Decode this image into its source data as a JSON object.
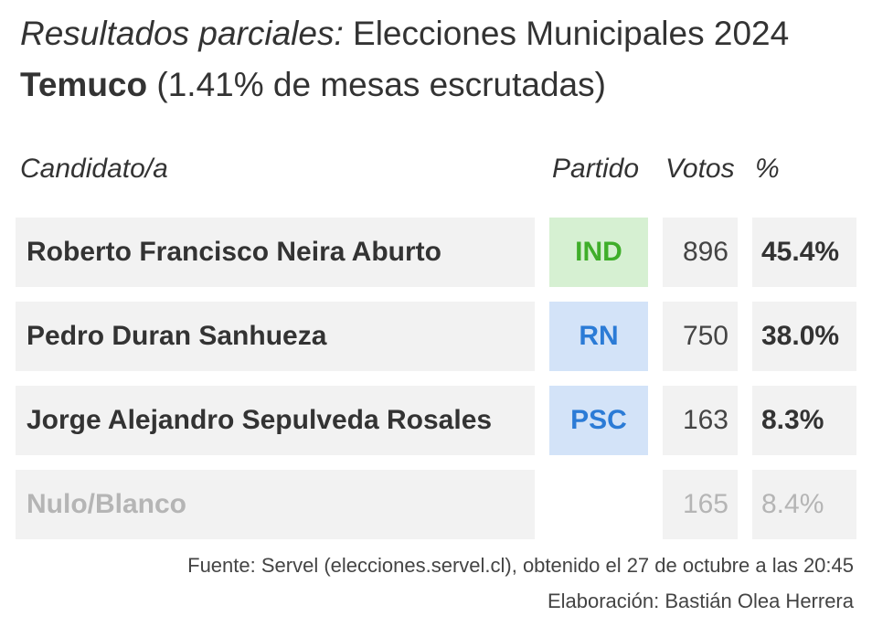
{
  "title": {
    "italic_part": "Resultados parciales:",
    "rest": " Elecciones Municipales 2024",
    "city": "Temuco",
    "progress_text": " (1.41% de mesas escrutadas)"
  },
  "columns": {
    "candidate": "Candidato/a",
    "party": "Partido",
    "votes": "Votos",
    "percent": "%"
  },
  "rows": [
    {
      "name": "Roberto Francisco Neira Aburto",
      "party": "IND",
      "party_bg": "#d6f0d2",
      "party_color": "#3fae2a",
      "votes": "896",
      "percent": "45.4%"
    },
    {
      "name": "Pedro Duran Sanhueza",
      "party": "RN",
      "party_bg": "#d3e3f8",
      "party_color": "#2b7bd6",
      "votes": "750",
      "percent": "38.0%"
    },
    {
      "name": "Jorge Alejandro Sepulveda Rosales",
      "party": "PSC",
      "party_bg": "#d3e3f8",
      "party_color": "#2b7bd6",
      "votes": "163",
      "percent": "8.3%"
    },
    {
      "name": "Nulo/Blanco",
      "party": "",
      "votes": "165",
      "percent": "8.4%"
    }
  ],
  "footer": {
    "source": "Fuente: Servel (elecciones.servel.cl), obtenido el 27 de octubre a las 20:45",
    "credit": "Elaboración: Bastián Olea Herrera"
  }
}
